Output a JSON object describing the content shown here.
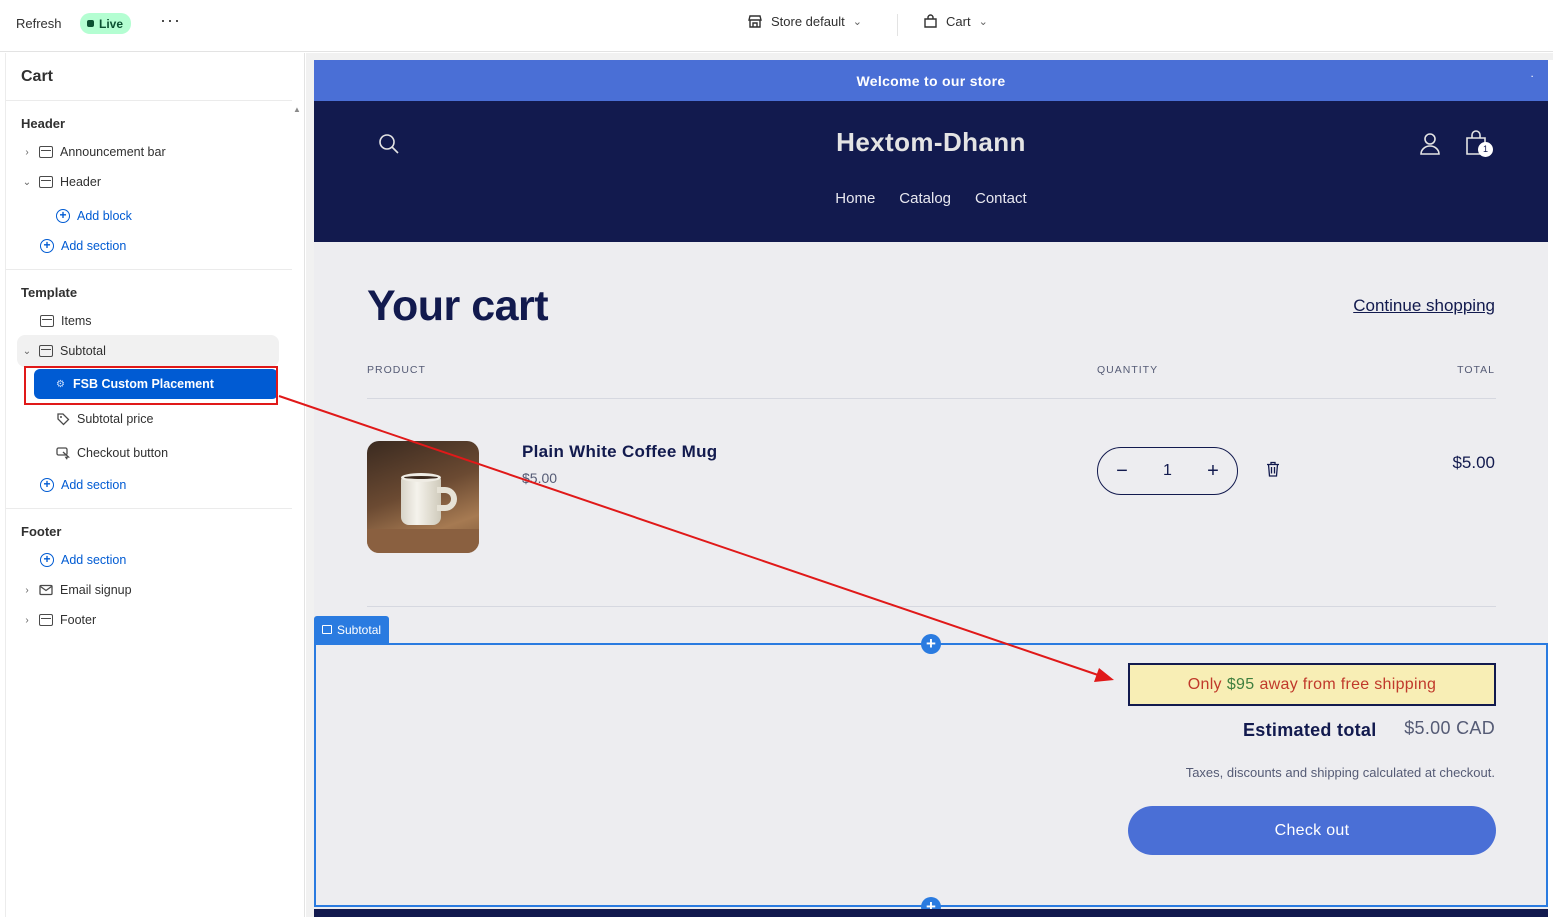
{
  "topbar": {
    "refresh_label": "Refresh",
    "live_label": "Live",
    "more_label": "···",
    "store_label": "Store default",
    "cart_label": "Cart"
  },
  "sidebar": {
    "title": "Cart",
    "header_group": "Header",
    "announcement_bar": "Announcement bar",
    "header_item": "Header",
    "add_block": "Add block",
    "add_section": "Add section",
    "template_group": "Template",
    "items": "Items",
    "subtotal": "Subtotal",
    "fsb_custom_placement": "FSB Custom Placement",
    "subtotal_price": "Subtotal price",
    "checkout_button": "Checkout button",
    "footer_group": "Footer",
    "email_signup": "Email signup",
    "footer_item": "Footer"
  },
  "store": {
    "announcement": "Welcome to our store",
    "logo": "Hextom-Dhann",
    "nav": [
      "Home",
      "Catalog",
      "Contact"
    ],
    "cart_count": "1"
  },
  "cart": {
    "title": "Your cart",
    "continue_shopping": "Continue shopping",
    "col_product": "PRODUCT",
    "col_quantity": "QUANTITY",
    "col_total": "TOTAL",
    "product_name": "Plain White Coffee Mug",
    "product_price": "$5.00",
    "quantity": "1",
    "line_total": "$5.00",
    "subtotal_tag": "Subtotal",
    "fsb_prefix": "Only",
    "fsb_amount": "$95",
    "fsb_suffix": "away from free shipping",
    "estimated_total_label": "Estimated total",
    "estimated_total_value": "$5.00 CAD",
    "taxes_note": "Taxes, discounts and shipping calculated at checkout.",
    "checkout_label": "Check out"
  },
  "colors": {
    "accent": "#005bd3",
    "header_bg": "#121a4e",
    "announcement_bg": "#4a6fd6",
    "annotation_red": "#e01919"
  }
}
